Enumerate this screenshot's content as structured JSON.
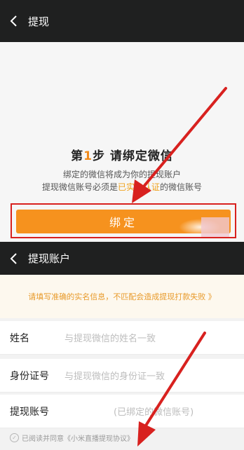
{
  "screen1": {
    "title": "提现",
    "step_prefix": "第",
    "step_number": "1",
    "step_rest": "步  请绑定微信",
    "line1": "绑定的微信将成为你的提现账户",
    "line2_pre": "提现微信账号必须是",
    "line2_highlight": "已实名认证",
    "line2_post": "的微信账号",
    "bind_button": "绑定"
  },
  "screen2": {
    "title": "提现账户",
    "notice": "请填写准确的实名信息，不匹配会造成提现打款失败 》",
    "fields": [
      {
        "label": "姓名",
        "placeholder": "与提现微信的姓名一致"
      },
      {
        "label": "身份证号",
        "placeholder": "与提现微信的身份证一致"
      },
      {
        "label": "提现账号",
        "placeholder": "(已绑定的微信账号)"
      }
    ],
    "agreement": "已阅读并同意《小米直播提现协议》"
  },
  "colors": {
    "topbar": "#1f2020",
    "accent_orange": "#f6921e",
    "highlight_yellow": "#f0a21b",
    "annotation_red": "#d8211f"
  }
}
